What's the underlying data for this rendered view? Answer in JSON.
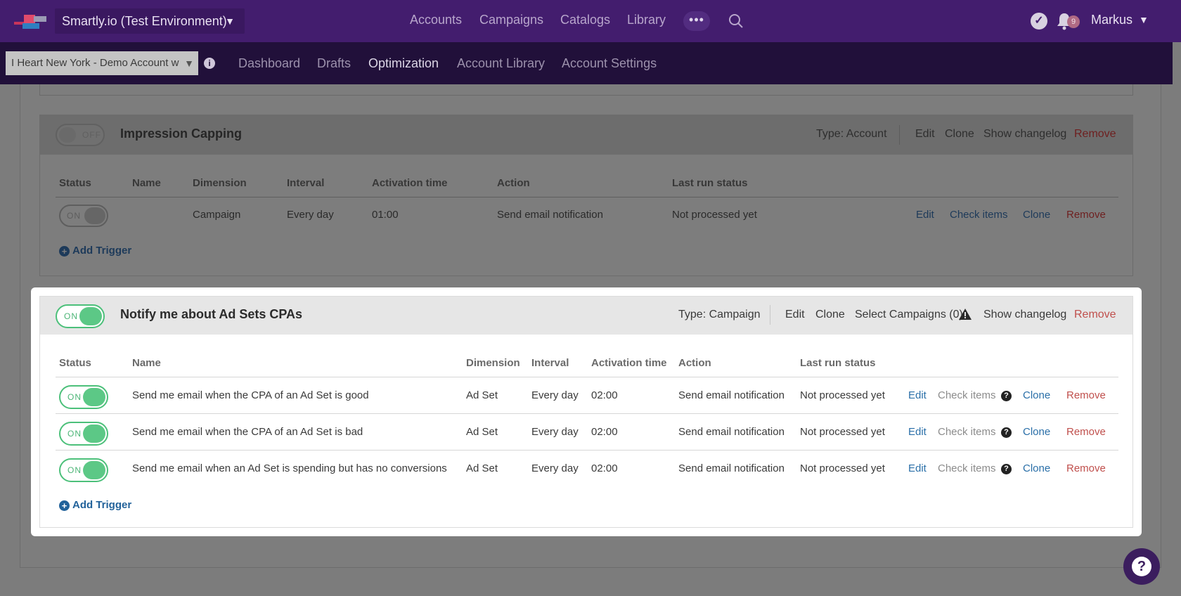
{
  "topbar": {
    "environment": "Smartly.io (Test Environment)",
    "nav": [
      "Accounts",
      "Campaigns",
      "Catalogs",
      "Library"
    ],
    "more": "•••",
    "notifications_count": "9",
    "user": "Markus"
  },
  "subbar": {
    "account": "I Heart New York - Demo Account w",
    "nav": [
      "Dashboard",
      "Drafts",
      "Optimization",
      "Account Library",
      "Account Settings"
    ],
    "active": "Optimization"
  },
  "cards": [
    {
      "title": "Impression Capping",
      "enabled": false,
      "toggle_label": "OFF",
      "type": "Type: Account",
      "actions": [
        "Edit",
        "Clone",
        "Show changelog",
        "Remove"
      ],
      "columns": [
        "Status",
        "Name",
        "Dimension",
        "Interval",
        "Activation time",
        "Action",
        "Last run status"
      ],
      "rows": [
        {
          "status": "ON",
          "name": "",
          "dimension": "Campaign",
          "interval": "Every day",
          "time": "01:00",
          "action": "Send email notification",
          "last_run": "Not processed yet",
          "links": [
            "Edit",
            "Check items",
            "Clone",
            "Remove"
          ]
        }
      ],
      "add_trigger": "Add Trigger"
    },
    {
      "title": "Notify me about Ad Sets CPAs",
      "enabled": true,
      "toggle_label": "ON",
      "type": "Type: Campaign",
      "actions": [
        "Edit",
        "Clone",
        "Select Campaigns (0)",
        "Show changelog",
        "Remove"
      ],
      "columns": [
        "Status",
        "Name",
        "Dimension",
        "Interval",
        "Activation time",
        "Action",
        "Last run status"
      ],
      "rows": [
        {
          "status": "ON",
          "name": "Send me email when the CPA of an Ad Set is good",
          "dimension": "Ad Set",
          "interval": "Every day",
          "time": "02:00",
          "action": "Send email notification",
          "last_run": "Not processed yet",
          "links": [
            "Edit",
            "Check items",
            "Clone",
            "Remove"
          ]
        },
        {
          "status": "ON",
          "name": "Send me email when the CPA of an Ad Set is bad",
          "dimension": "Ad Set",
          "interval": "Every day",
          "time": "02:00",
          "action": "Send email notification",
          "last_run": "Not processed yet",
          "links": [
            "Edit",
            "Check items",
            "Clone",
            "Remove"
          ]
        },
        {
          "status": "ON",
          "name": "Send me email when an Ad Set is spending but has no conversions",
          "dimension": "Ad Set",
          "interval": "Every day",
          "time": "02:00",
          "action": "Send email notification",
          "last_run": "Not processed yet",
          "links": [
            "Edit",
            "Check items",
            "Clone",
            "Remove"
          ]
        }
      ],
      "add_trigger": "Add Trigger"
    }
  ],
  "colors": {
    "topbar": "#431d6e",
    "subbar": "#21103a",
    "toggle_on": "#5cc886",
    "link": "#2a6fa8",
    "remove": "#c0504d"
  }
}
